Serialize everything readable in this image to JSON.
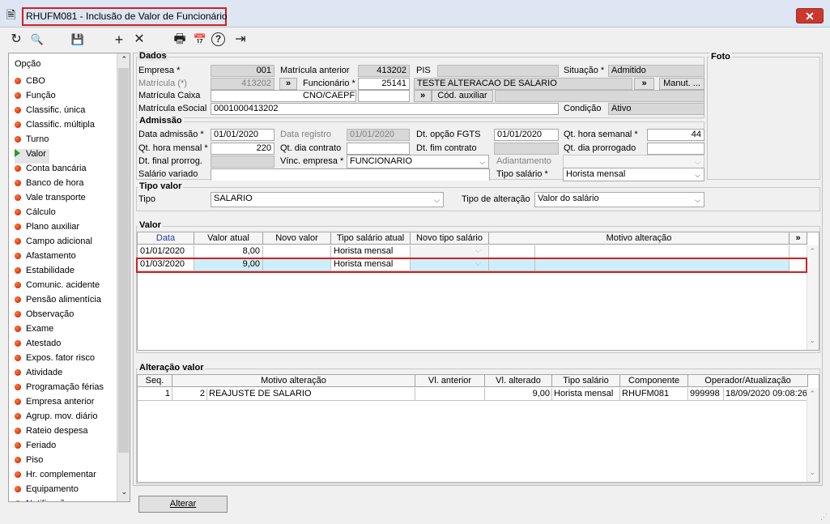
{
  "window": {
    "title": "RHUFM081 - Inclusão de Valor de Funcionário",
    "close": "✕"
  },
  "toolbar": {
    "refresh": "↻",
    "search": "🔍",
    "save": "💾",
    "add": "+",
    "delete": "✕",
    "print": "🖶",
    "calendar": "📅",
    "help": "?",
    "exit": "⇥"
  },
  "sidebar": {
    "header": "Opção",
    "items": [
      "CBO",
      "Função",
      "Classific. única",
      "Classific. múltipla",
      "Turno",
      "Valor",
      "Conta bancária",
      "Banco de hora",
      "Vale transporte",
      "Cálculo",
      "Plano auxiliar",
      "Campo adicional",
      "Afastamento",
      "Estabilidade",
      "Comunic. acidente",
      "Pensão alimentícia",
      "Observação",
      "Exame",
      "Atestado",
      "Expos. fator risco",
      "Atividade",
      "Programação férias",
      "Empresa anterior",
      "Agrup. mov. diário",
      "Rateio despesa",
      "Feriado",
      "Piso",
      "Hr. complementar",
      "Equipamento",
      "Notificação"
    ],
    "active_index": 5
  },
  "dados": {
    "title": "Dados",
    "empresa_label": "Empresa *",
    "empresa": "001",
    "mat_anterior_label": "Matrícula anterior",
    "mat_anterior": "413202",
    "pis_label": "PIS",
    "pis": "",
    "situacao_label": "Situação *",
    "situacao": "Admitido",
    "matricula_label": "Matrícula (*)",
    "matricula": "413202",
    "funcionario_label": "Funcionário *",
    "funcionario": "25141",
    "funcionario_nome": "TESTE ALTERACAO DE SALARIO",
    "manut_btn": "Manut. ...",
    "mat_caixa_label": "Matrícula Caixa",
    "cno_label": "CNO/CAEPF",
    "cod_aux_btn": "Cód. auxiliar",
    "mat_esocial_label": "Matrícula eSocial",
    "mat_esocial": "0001000413202",
    "condicao_label": "Condição",
    "condicao": "Ativo"
  },
  "admissao": {
    "title": "Admissão",
    "data_adm_label": "Data admissão *",
    "data_adm": "01/01/2020",
    "data_reg_label": "Data registro",
    "data_reg": "01/01/2020",
    "dt_fgts_label": "Dt. opção FGTS",
    "dt_fgts": "01/01/2020",
    "qt_semanal_label": "Qt. hora semanal *",
    "qt_semanal": "44",
    "qt_mensal_label": "Qt. hora mensal *",
    "qt_mensal": "220",
    "qt_dia_contrato_label": "Qt. dia contrato",
    "dt_fim_contrato_label": "Dt. fim contrato",
    "qt_dia_prorrogado_label": "Qt. dia prorrogado",
    "dt_final_prorrog_label": "Dt. final prorrog.",
    "vinc_empresa_label": "Vínc. empresa *",
    "vinc_empresa": "FUNCIONARIO",
    "adiantamento_label": "Adiantamento",
    "salario_variado_label": "Salário variado",
    "tipo_salario_label": "Tipo salário *",
    "tipo_salario": "Horista mensal"
  },
  "tipo_valor": {
    "title": "Tipo valor",
    "tipo_label": "Tipo",
    "tipo": "SALARIO",
    "tipo_alt_label": "Tipo de alteração",
    "tipo_alt": "Valor do salário"
  },
  "valor": {
    "title": "Valor",
    "columns": [
      "Data",
      "Valor atual",
      "Novo valor",
      "Tipo salário atual",
      "Novo tipo salário",
      "Motivo alteração"
    ],
    "expand": "»",
    "rows": [
      [
        "01/01/2020",
        "8,00",
        "",
        "Horista mensal",
        "",
        ""
      ],
      [
        "01/03/2020",
        "9,00",
        "",
        "Horista mensal",
        "",
        ""
      ]
    ]
  },
  "alteracao": {
    "title": "Alteração valor",
    "columns": [
      "Seq.",
      "Motivo alteração",
      "Vl. anterior",
      "Vl. alterado",
      "Tipo salário",
      "Componente",
      "Operador/Atualização"
    ],
    "rows": [
      [
        "1",
        "2",
        "REAJUSTE DE SALARIO",
        "",
        "9,00",
        "Horista mensal",
        "RHUFM081",
        "999998",
        "18/09/2020 09:08:26"
      ]
    ]
  },
  "foto": {
    "title": "Foto"
  },
  "footer": {
    "alterar": "Alterar"
  },
  "colors": {
    "highlight_red": "#d02020",
    "row_selected": "#cdeffb",
    "bullet": "#d42000"
  }
}
